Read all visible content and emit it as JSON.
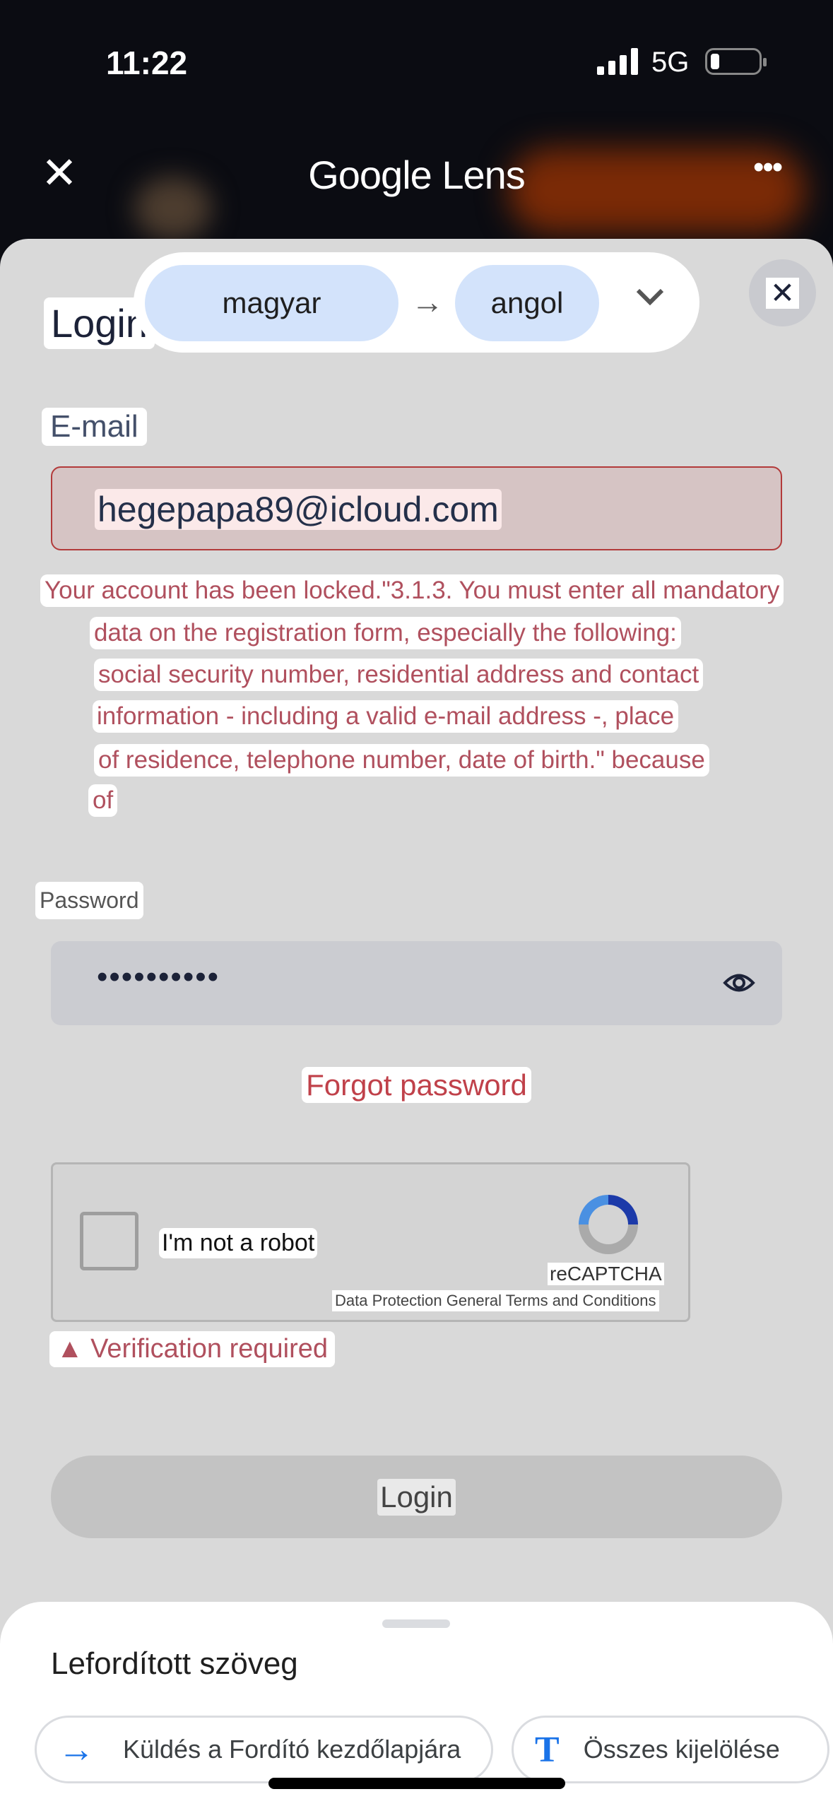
{
  "status_bar": {
    "time": "11:22",
    "network": "5G",
    "battery_level": 0.1
  },
  "header": {
    "title": "Google Lens",
    "close_icon": "close-icon",
    "more_icon": "more-horizontal-icon"
  },
  "language_bar": {
    "source": "magyar",
    "target": "angol"
  },
  "form": {
    "title": "Login",
    "email_label": "E-mail",
    "email_value": "hegepapa89@icloud.com",
    "error_lines": [
      "Your account has been locked.\"3.1.3. You must enter all mandatory",
      "data on the registration form, especially the following:",
      "social security number, residential address and contact",
      "information - including a valid e-mail address -, place",
      "of residence, telephone number, date of birth.\" because",
      "of"
    ],
    "password_label": "Password",
    "password_value": "••••••••••",
    "forgot_password": "Forgot password",
    "captcha": {
      "label": "I'm not a robot",
      "brand": "reCAPTCHA",
      "terms": "Data Protection General Terms and Conditions"
    },
    "verification_error": "▲ Verification required",
    "login_button": "Login"
  },
  "bottom_sheet": {
    "title": "Lefordított szöveg",
    "send_button": "Küldés a Fordító kezdőlapjára",
    "select_all_button": "Összes kijelölése",
    "accent": "#1a73e8"
  }
}
